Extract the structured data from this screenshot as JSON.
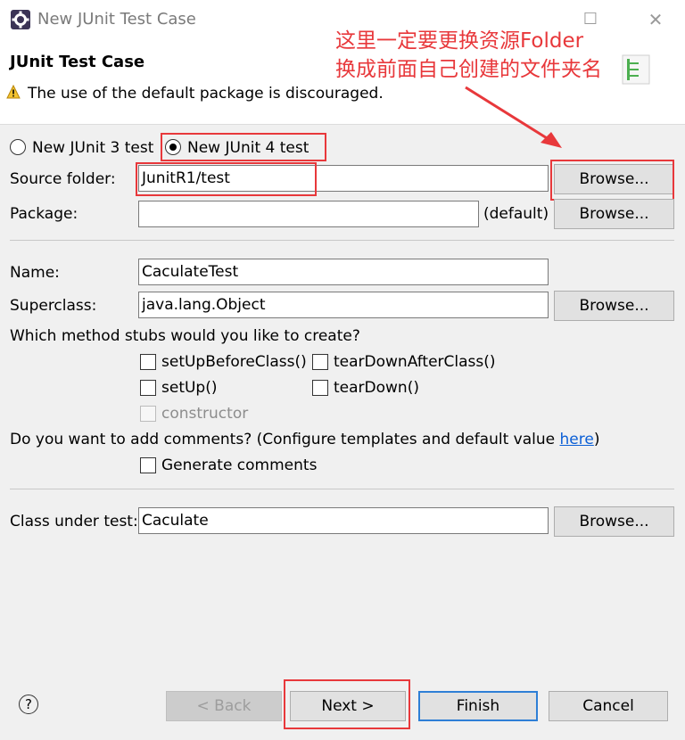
{
  "window": {
    "title": "New JUnit Test Case",
    "minimize_symbol": "—",
    "maximize_symbol": "☐",
    "close_symbol": "✕"
  },
  "header": {
    "heading": "JUnit Test Case",
    "warning": "The use of the default package is discouraged."
  },
  "annotation": {
    "line1": "这里一定要更换资源Folder",
    "line2": "换成前面自己创建的文件夹名",
    "color": "#e8383b"
  },
  "form": {
    "radio_junit3": "New JUnit 3 test",
    "radio_junit4": "New JUnit 4 test",
    "source_folder_label": "Source folder:",
    "source_folder_value": "JunitR1/test",
    "package_label": "Package:",
    "package_value": "",
    "package_default": "(default)",
    "name_label": "Name:",
    "name_value": "CaculateTest",
    "superclass_label": "Superclass:",
    "superclass_value": "java.lang.Object",
    "stubs_question": "Which method stubs would you like to create?",
    "stubs": {
      "setup_before_class": "setUpBeforeClass()",
      "teardown_after_class": "tearDownAfterClass()",
      "setup": "setUp()",
      "teardown": "tearDown()",
      "constructor": "constructor"
    },
    "comments_question": "Do you want to add comments? (Configure templates and default value ",
    "comments_link": "here",
    "comments_close": ")",
    "generate_comments": "Generate comments",
    "class_under_test_label": "Class under test:",
    "class_under_test_value": "Caculate",
    "browse_label": "Browse..."
  },
  "footer": {
    "help": "?",
    "back": "< Back",
    "next": "Next >",
    "finish": "Finish",
    "cancel": "Cancel"
  }
}
